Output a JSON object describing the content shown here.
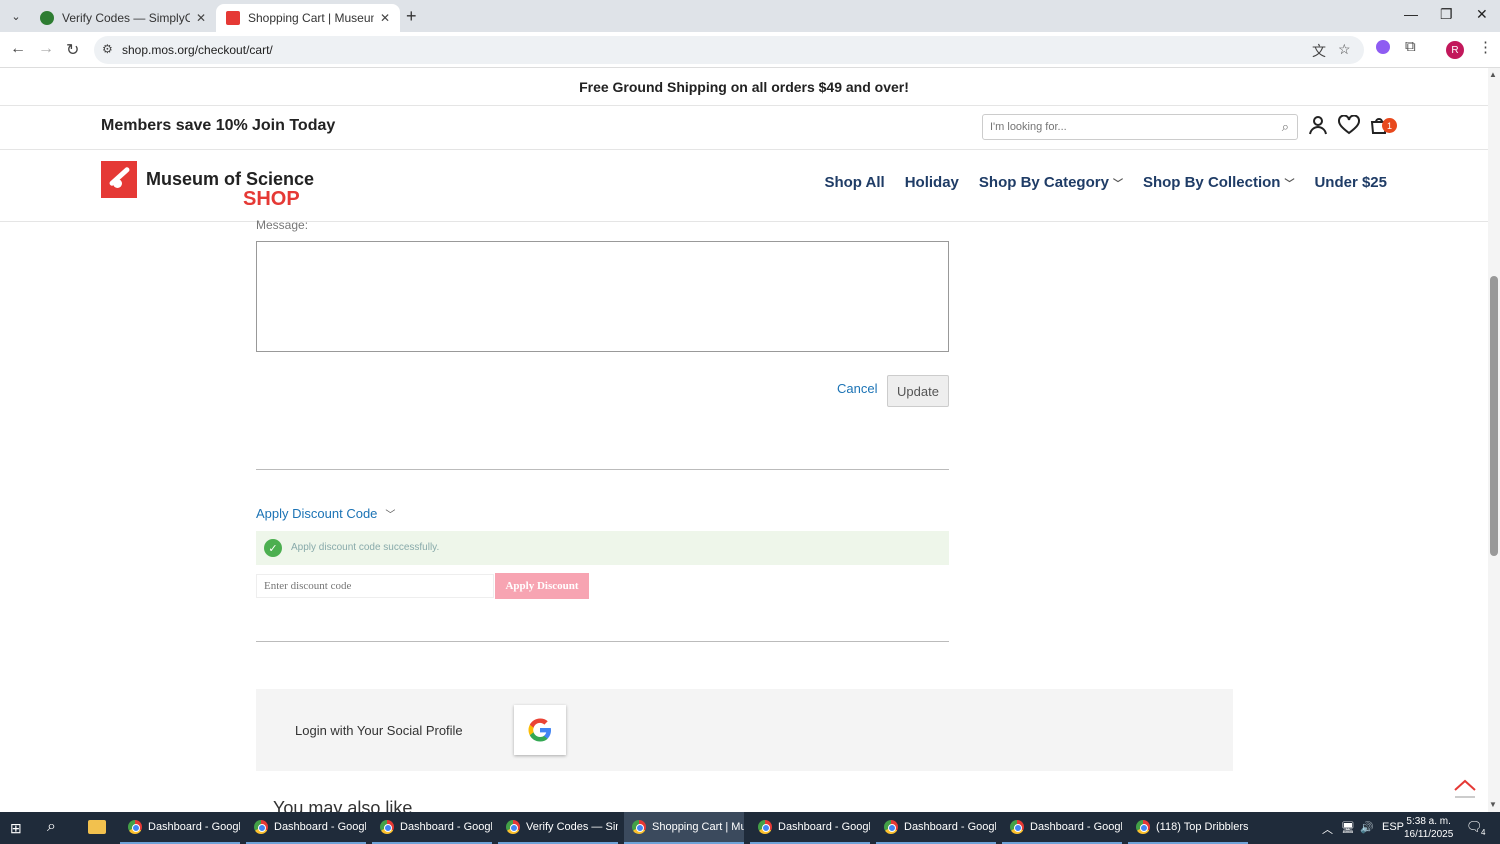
{
  "browser": {
    "tabs": [
      {
        "title": "Verify Codes — SimplyCodes",
        "active": false
      },
      {
        "title": "Shopping Cart | Museum of Sci",
        "active": true
      }
    ],
    "url": "shop.mos.org/checkout/cart/",
    "profile_initial": "R"
  },
  "site": {
    "promo": "Free Ground Shipping on all orders $49 and over!",
    "members_save": "Members save 10%",
    "join_today": "Join Today",
    "search_placeholder": "I'm looking for...",
    "cart_count": "1",
    "logo_line1": "Museum of Science",
    "logo_line2": "SHOP",
    "menu": [
      {
        "label": "Shop All",
        "dropdown": false
      },
      {
        "label": "Holiday",
        "dropdown": false
      },
      {
        "label": "Shop By Category",
        "dropdown": true
      },
      {
        "label": "Shop By Collection",
        "dropdown": true
      },
      {
        "label": "Under $25",
        "dropdown": false
      }
    ]
  },
  "cart": {
    "message_label": "Message:",
    "message_value": "",
    "cancel_label": "Cancel",
    "update_label": "Update",
    "discount_toggle": "Apply Discount Code",
    "discount_success": "Apply discount code successfully.",
    "discount_placeholder": "Enter discount code",
    "apply_discount_label": "Apply Discount",
    "social_login_label": "Login with Your Social Profile",
    "also_like": "You may also like"
  },
  "taskbar": {
    "items": [
      {
        "label": "Dashboard - Googl...",
        "active": false
      },
      {
        "label": "Dashboard - Googl...",
        "active": false
      },
      {
        "label": "Dashboard - Googl...",
        "active": false
      },
      {
        "label": "Verify Codes — Sim...",
        "active": false
      },
      {
        "label": "Shopping Cart | Mu...",
        "active": true
      },
      {
        "label": "Dashboard - Googl...",
        "active": false
      },
      {
        "label": "Dashboard - Googl...",
        "active": false
      },
      {
        "label": "Dashboard - Googl...",
        "active": false
      },
      {
        "label": "(118) Top Dribblers ...",
        "active": false
      }
    ],
    "language": "ESP",
    "time": "5:38 a. m.",
    "date": "16/11/2025",
    "notifications": "4"
  },
  "colors": {
    "brand_red": "#e53935",
    "nav_blue": "#1f3c66",
    "link_blue": "#1b73b5",
    "apply_pink": "#f7a4b2",
    "success_green": "#4caf50"
  }
}
